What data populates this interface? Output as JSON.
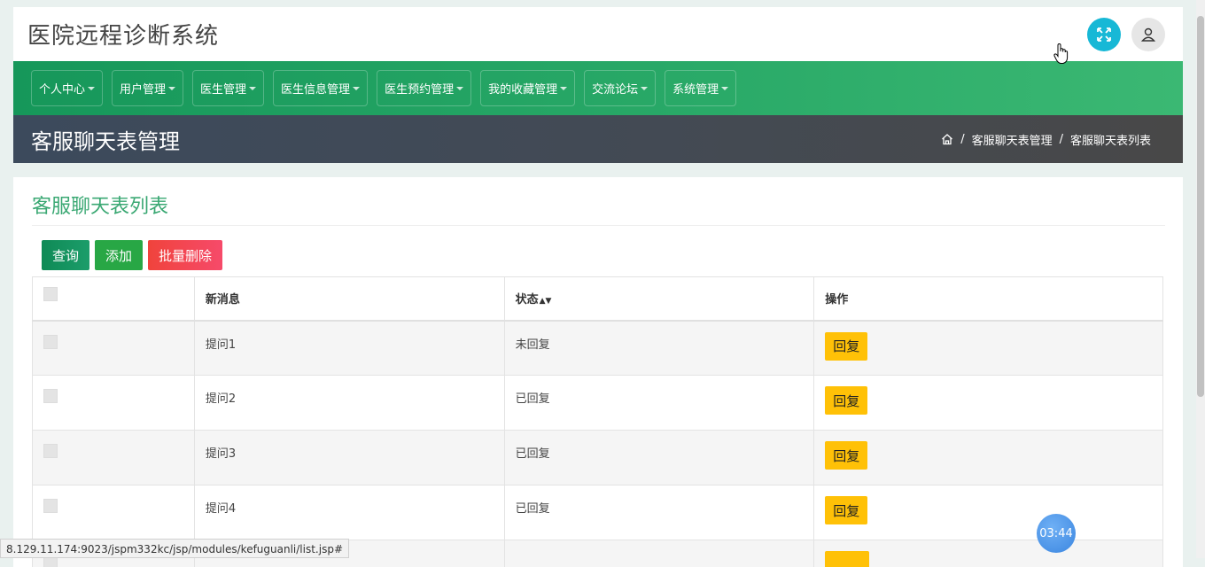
{
  "header": {
    "title": "医院远程诊断系统"
  },
  "nav": {
    "items": [
      {
        "label": "个人中心"
      },
      {
        "label": "用户管理"
      },
      {
        "label": "医生管理"
      },
      {
        "label": "医生信息管理"
      },
      {
        "label": "医生预约管理"
      },
      {
        "label": "我的收藏管理"
      },
      {
        "label": "交流论坛"
      },
      {
        "label": "系统管理"
      }
    ]
  },
  "page": {
    "title": "客服聊天表管理",
    "breadcrumb": [
      "客服聊天表管理",
      "客服聊天表列表"
    ]
  },
  "card": {
    "title": "客服聊天表列表",
    "toolbar": {
      "query_label": "查询",
      "add_label": "添加",
      "delete_label": "批量删除"
    },
    "table": {
      "columns": [
        "新消息",
        "状态",
        "操作"
      ],
      "rows": [
        {
          "message": "提问1",
          "status": "未回复",
          "action": "回复"
        },
        {
          "message": "提问2",
          "status": "已回复",
          "action": "回复"
        },
        {
          "message": "提问3",
          "status": "已回复",
          "action": "回复"
        },
        {
          "message": "提问4",
          "status": "已回复",
          "action": "回复"
        },
        {
          "message": "",
          "status": "",
          "action": ""
        }
      ]
    }
  },
  "status_bar": {
    "url": "8.129.11.174:9023/jspm332kc/jsp/modules/kefuguanli/list.jsp#"
  },
  "timer": {
    "value": "03:44"
  },
  "colors": {
    "nav_green": "#2aaa68",
    "title_bar": "#434a54",
    "accent_text": "#3aa873",
    "reply_yellow": "#ffc107",
    "delete_red": "#f0433c"
  }
}
